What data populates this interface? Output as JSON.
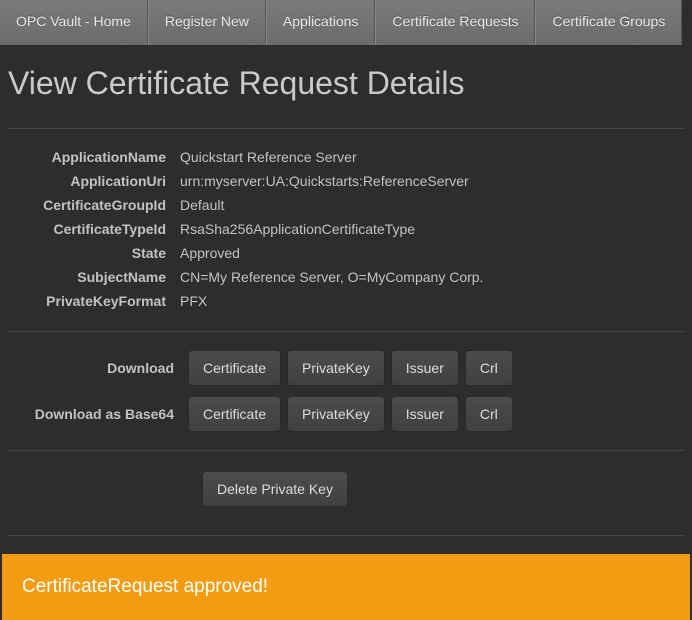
{
  "nav": {
    "items": [
      "OPC Vault - Home",
      "Register New",
      "Applications",
      "Certificate Requests",
      "Certificate Groups"
    ]
  },
  "page": {
    "title": "View Certificate Request Details"
  },
  "details": {
    "rows": [
      {
        "label": "ApplicationName",
        "value": "Quickstart Reference Server"
      },
      {
        "label": "ApplicationUri",
        "value": "urn:myserver:UA:Quickstarts:ReferenceServer"
      },
      {
        "label": "CertificateGroupId",
        "value": "Default"
      },
      {
        "label": "CertificateTypeId",
        "value": "RsaSha256ApplicationCertificateType"
      },
      {
        "label": "State",
        "value": "Approved"
      },
      {
        "label": "SubjectName",
        "value": "CN=My Reference Server, O=MyCompany Corp."
      },
      {
        "label": "PrivateKeyFormat",
        "value": "PFX"
      }
    ]
  },
  "download": {
    "label": "Download",
    "buttons": [
      "Certificate",
      "PrivateKey",
      "Issuer",
      "Crl"
    ]
  },
  "downloadBase64": {
    "label": "Download as Base64",
    "buttons": [
      "Certificate",
      "PrivateKey",
      "Issuer",
      "Crl"
    ]
  },
  "deleteAction": {
    "label": "Delete Private Key"
  },
  "alert": {
    "message": "CertificateRequest approved!"
  }
}
